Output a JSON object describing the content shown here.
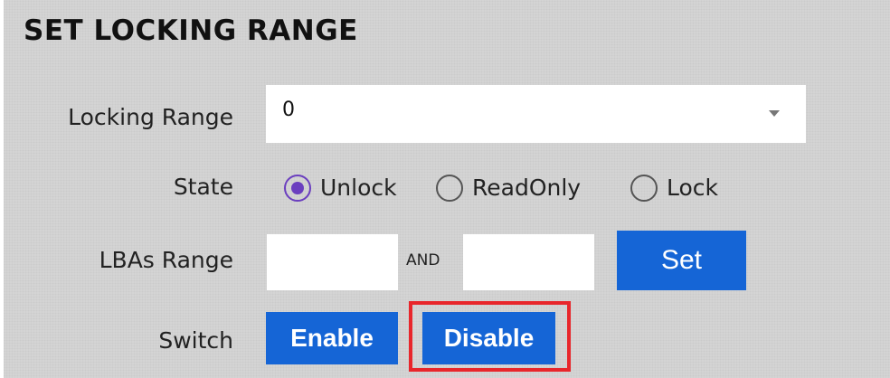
{
  "panel": {
    "title": "SET LOCKING RANGE"
  },
  "form": {
    "locking_range": {
      "label": "Locking Range",
      "selected_value": "0"
    },
    "state": {
      "label": "State",
      "selected": "Unlock",
      "options": [
        {
          "label": "Unlock",
          "checked": true
        },
        {
          "label": "ReadOnly",
          "checked": false
        },
        {
          "label": "Lock",
          "checked": false
        }
      ]
    },
    "lbas_range": {
      "label": "LBAs Range",
      "start_value": "",
      "end_value": "",
      "separator": "AND",
      "set_button": "Set"
    },
    "switch": {
      "label": "Switch",
      "enable_button": "Enable",
      "disable_button": "Disable"
    }
  },
  "colors": {
    "background": "#d6d6d6",
    "button_blue": "#1565d6",
    "radio_accent": "#6b3fbf",
    "highlight_red": "#e8262b"
  }
}
